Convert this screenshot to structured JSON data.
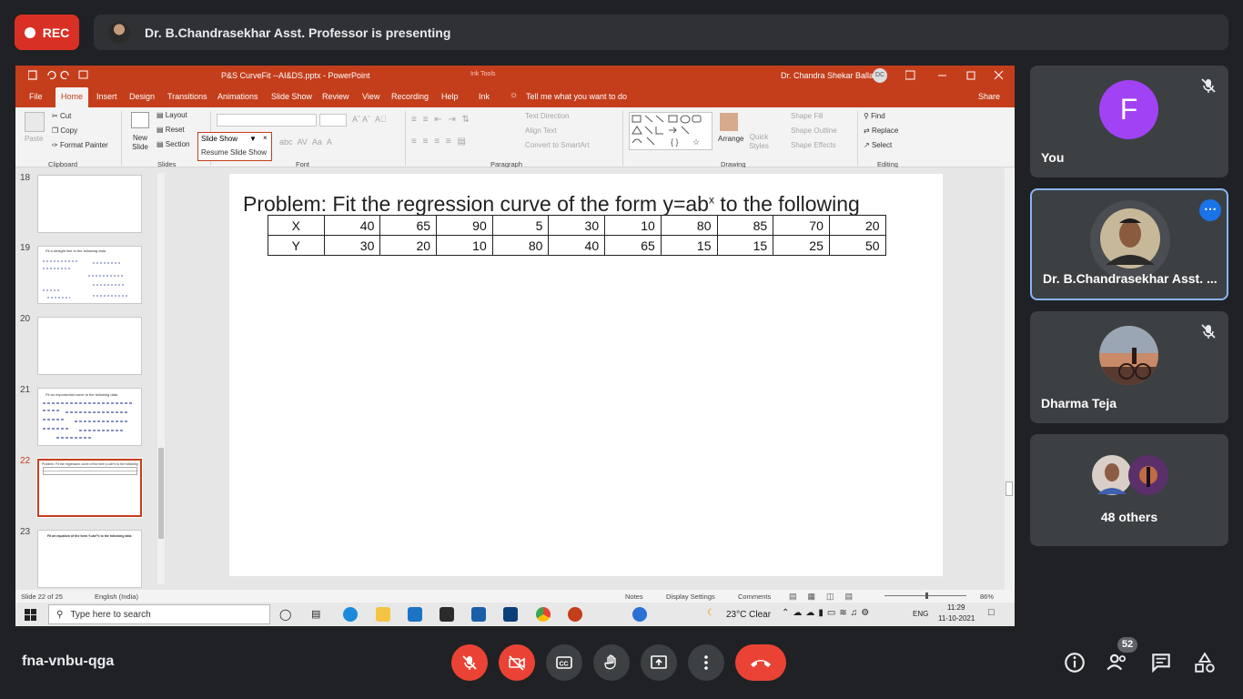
{
  "meet": {
    "rec_label": "REC",
    "presenting_text": "Dr. B.Chandrasekhar Asst. Professor is presenting",
    "meeting_code": "fna-vnbu-qga",
    "participant_count_badge": "52"
  },
  "participants": [
    {
      "initial": "F",
      "name": "You",
      "avatar_color": "#a142f4",
      "muted": true
    },
    {
      "name": "Dr. B.Chandrasekhar Asst. ...",
      "muted": false,
      "active": true
    },
    {
      "name": "Dharma Teja",
      "muted": true
    },
    {
      "name": "48 others"
    }
  ],
  "ppt": {
    "window_title": "P&S CurveFit --AI&DS.pptx  -  PowerPoint",
    "ink_tools_label": "Ink Tools",
    "user_name": "Dr. Chandra Shekar Balla",
    "user_initials": "DC",
    "tabs": [
      "File",
      "Home",
      "Insert",
      "Design",
      "Transitions",
      "Animations",
      "Slide Show",
      "Review",
      "View",
      "Recording",
      "Help",
      "Ink"
    ],
    "tell_me": "Tell me what you want to do",
    "share": "Share",
    "ribbon": {
      "clipboard": {
        "paste": "Paste",
        "cut": "Cut",
        "copy": "Copy",
        "format_painter": "Format Painter",
        "group": "Clipboard"
      },
      "slides": {
        "new_slide": "New Slide",
        "layout": "Layout",
        "reset": "Reset",
        "section": "Section",
        "group": "Slides"
      },
      "font_group": "Font",
      "paragraph": {
        "text_direction": "Text Direction",
        "align_text": "Align Text",
        "convert_smartart": "Convert to SmartArt",
        "group": "Paragraph"
      },
      "drawing": {
        "arrange": "Arrange",
        "quick_styles": "Quick Styles",
        "shape_fill": "Shape Fill",
        "shape_outline": "Shape Outline",
        "shape_effects": "Shape Effects",
        "group": "Drawing"
      },
      "editing": {
        "find": "Find",
        "replace": "Replace",
        "select": "Select",
        "group": "Editing"
      }
    },
    "slideshow_menu": {
      "title": "Slide Show",
      "item": "Resume Slide Show"
    },
    "thumbnails": [
      {
        "num": "18"
      },
      {
        "num": "19",
        "caption": "Fit a straight line to the following data"
      },
      {
        "num": "20"
      },
      {
        "num": "21",
        "caption": "Fit an exponential curve to the following data"
      },
      {
        "num": "22",
        "caption": "Problem: Fit the regression curve of the form y=ab^x to the following",
        "selected": true
      },
      {
        "num": "23",
        "caption": "Fit an equation of the form Y=ab^x to the following data"
      }
    ],
    "slide": {
      "title_prefix": "Problem: Fit the regression curve of the form y=ab",
      "title_sup": "x",
      "title_suffix": " to the following",
      "table": {
        "rows": [
          {
            "label": "X",
            "values": [
              "40",
              "65",
              "90",
              "5",
              "30",
              "10",
              "80",
              "85",
              "70",
              "20"
            ]
          },
          {
            "label": "Y",
            "values": [
              "30",
              "20",
              "10",
              "80",
              "40",
              "65",
              "15",
              "15",
              "25",
              "50"
            ]
          }
        ]
      }
    },
    "status": {
      "slide_of": "Slide 22 of 25",
      "language": "English (India)",
      "notes": "Notes",
      "display_settings": "Display Settings",
      "comments": "Comments",
      "zoom": "86%"
    },
    "taskbar": {
      "search_placeholder": "Type here to search",
      "weather": "23°C  Clear",
      "lang": "ENG",
      "time": "11:29",
      "date": "11-10-2021"
    }
  }
}
